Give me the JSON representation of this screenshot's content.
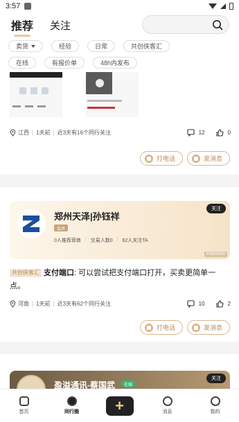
{
  "status": {
    "time": "3:57"
  },
  "header": {
    "tabs": [
      {
        "label": "推荐"
      },
      {
        "label": "关注"
      }
    ]
  },
  "filters": {
    "row1": [
      "卖货",
      "经验",
      "日常",
      "共创侠客汇"
    ],
    "row2": [
      "在线",
      "有报价单",
      "48h内发布"
    ]
  },
  "card1": {
    "location": "江西",
    "time": "1天前",
    "follow_text": "近3天有16个同行关注",
    "comments": "12",
    "likes": "0",
    "call_label": "打电话",
    "msg_label": "发消息"
  },
  "card2": {
    "name": "郑州天泽|孙钰祥",
    "member_tag": "会员",
    "stats": [
      "0人推荐菲商",
      "交易人数0",
      "62人关注TA"
    ],
    "follow_label": "关注",
    "id_badge": "P9890280",
    "post_tag": "共创侠客汇",
    "post_title": "支付端口",
    "post_body": ": 可以尝试把支付端口打开，买卖更简单一点。",
    "location": "河南",
    "time": "1天前",
    "follow_text": "近3天有62个同行关注",
    "comments": "10",
    "likes": "2",
    "call_label": "打电话",
    "msg_label": "发消息"
  },
  "card3": {
    "name": "盈溢通讯-蔡国武",
    "online": "在线",
    "follow_label": "关注"
  },
  "nav": [
    {
      "label": "首页"
    },
    {
      "label": "同行圈"
    },
    {
      "label": "+"
    },
    {
      "label": "消息"
    },
    {
      "label": "我的"
    }
  ]
}
